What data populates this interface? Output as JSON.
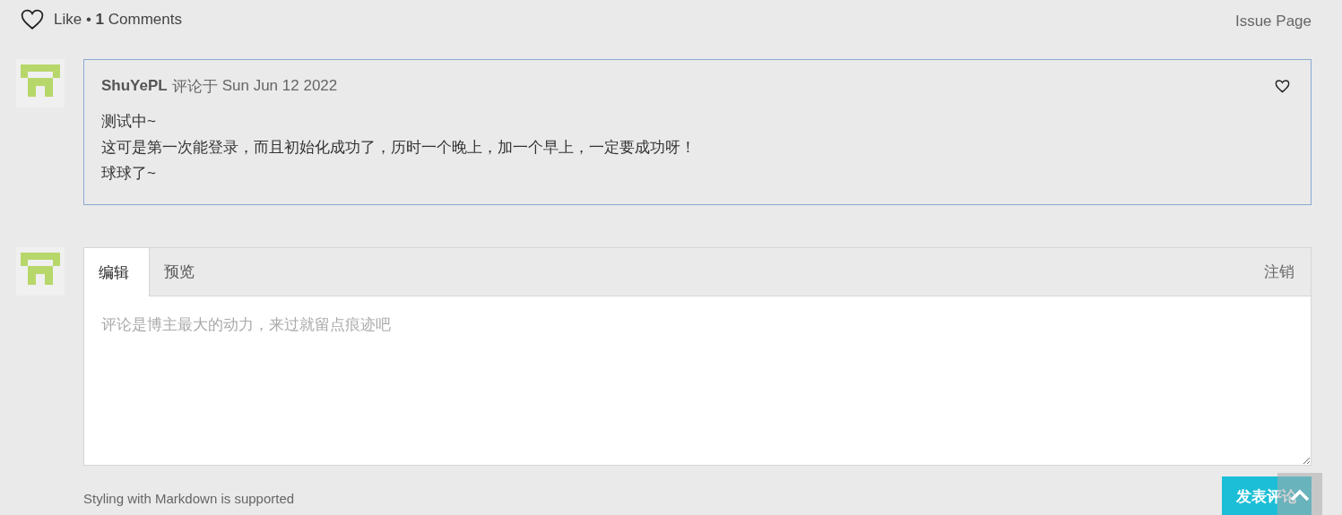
{
  "header": {
    "like": "Like • **1** Comments",
    "issue_link": "Issue Page"
  },
  "comments": [
    {
      "author": "ShuYePL",
      "verb": "评论于",
      "date": "Sun Jun 12 2022",
      "liked": false,
      "lines": [
        "测试中~",
        "这可是第一次能登录，而且初始化成功了，历时一个晚上，加一个早上，一定要成功呀！",
        "球球了~"
      ]
    }
  ],
  "editor": {
    "tabs": [
      {
        "label": "编辑",
        "selected": true
      },
      {
        "label": "预览",
        "selected": false
      }
    ],
    "logout": "注销",
    "placeholder": "评论是博主最大的动力，来过就留点痕迹吧",
    "hint": "Styling with Markdown is supported",
    "submit": "发表评论"
  }
}
